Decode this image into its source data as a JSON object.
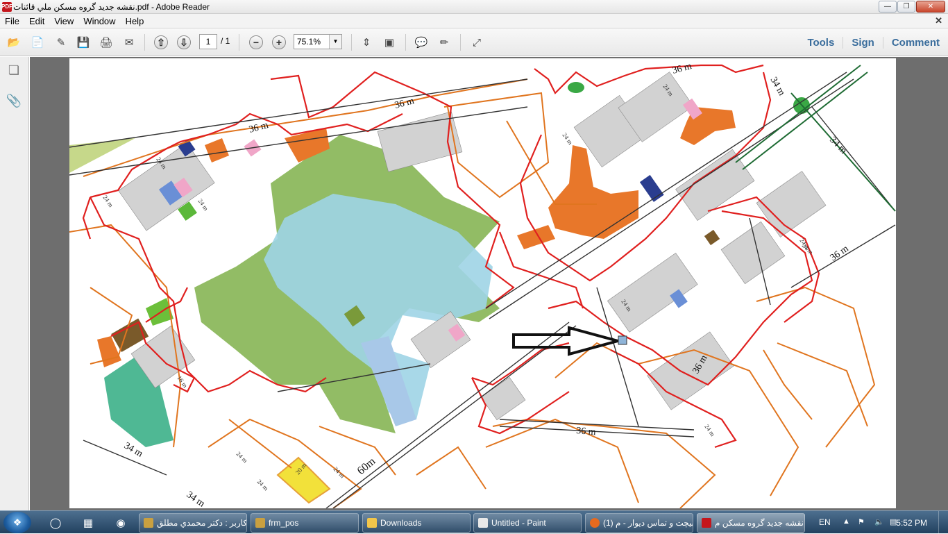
{
  "window": {
    "title": "نقشه جديد گروه مسکن ملي قائنات.pdf - Adobe Reader",
    "app_icon_label": "PDF"
  },
  "menu": [
    "File",
    "Edit",
    "View",
    "Window",
    "Help"
  ],
  "toolbar": {
    "page_current": "1",
    "page_total": "/ 1",
    "zoom": "75.1%",
    "links": [
      "Tools",
      "Sign",
      "Comment"
    ]
  },
  "map_labels": {
    "top_road": "36 m",
    "left_road": "36 m",
    "right_road_34": "34 m",
    "right_road_36": "36 m",
    "bottom_road": "36 m",
    "road_60": "60m",
    "road_34_left": "34 m",
    "road_34_bottom": "34 m",
    "street_24": "24 m",
    "street_20": "20 m",
    "street_16": "16 m"
  },
  "taskbar": {
    "items": [
      {
        "label": "کاربر : دکتر محمدي مطلق",
        "icon": "app-window-icon"
      },
      {
        "label": "frm_pos",
        "icon": "app-window-icon"
      },
      {
        "label": "Downloads",
        "icon": "folder-icon"
      },
      {
        "label": "Untitled - Paint",
        "icon": "paint-icon"
      },
      {
        "label": "(1) بیچت و تماس دیوار - م",
        "icon": "firefox-icon"
      },
      {
        "label": "نقشه جديد گروه مسکن م...",
        "icon": "pdf-icon"
      }
    ],
    "language": "EN",
    "clock": "5:52 PM"
  }
}
